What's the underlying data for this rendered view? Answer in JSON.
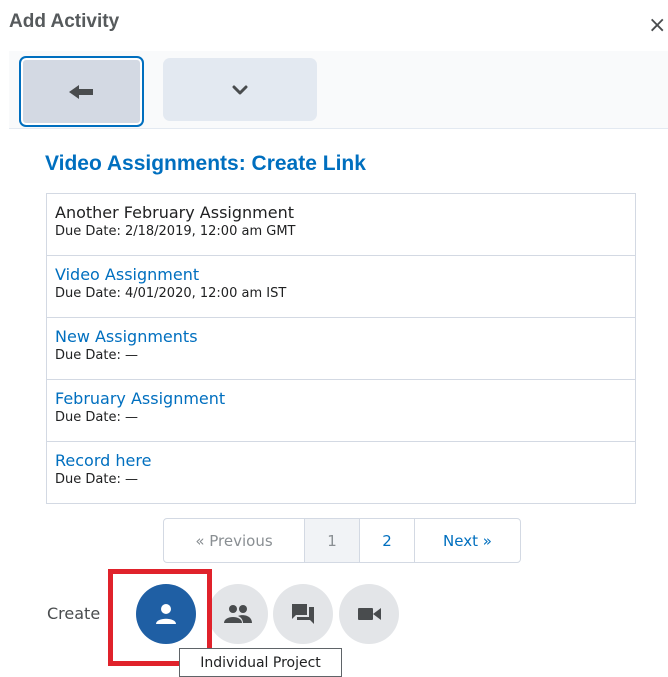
{
  "dialog": {
    "title": "Add Activity",
    "close_glyph": "×"
  },
  "toolbar": {
    "back_icon": "arrow-left-icon",
    "dropdown_icon": "chevron-down-icon"
  },
  "section": {
    "title": "Video Assignments: Create Link"
  },
  "assignments": [
    {
      "title": "Another February Assignment",
      "due": "Due Date: 2/18/2019, 12:00 am GMT",
      "link": false
    },
    {
      "title": "Video Assignment",
      "due": "Due Date: 4/01/2020, 12:00 am IST",
      "link": true
    },
    {
      "title": "New Assignments",
      "due": "Due Date: —",
      "link": true
    },
    {
      "title": "February Assignment",
      "due": "Due Date: —",
      "link": true
    },
    {
      "title": "Record here",
      "due": "Due Date: —",
      "link": true
    }
  ],
  "pagination": {
    "previous": "« Previous",
    "page1": "1",
    "page2": "2",
    "next": "Next »",
    "current_page": 1
  },
  "create": {
    "label": "Create",
    "buttons": [
      {
        "icon": "person-icon",
        "active": true
      },
      {
        "icon": "people-icon",
        "active": false
      },
      {
        "icon": "discussion-icon",
        "active": false
      },
      {
        "icon": "video-camera-icon",
        "active": false
      }
    ],
    "tooltip": "Individual Project"
  },
  "colors": {
    "link": "#006fbf",
    "active_button": "#1f5fa4",
    "inactive_button": "#e3e5e8",
    "highlight": "#e0222b"
  }
}
